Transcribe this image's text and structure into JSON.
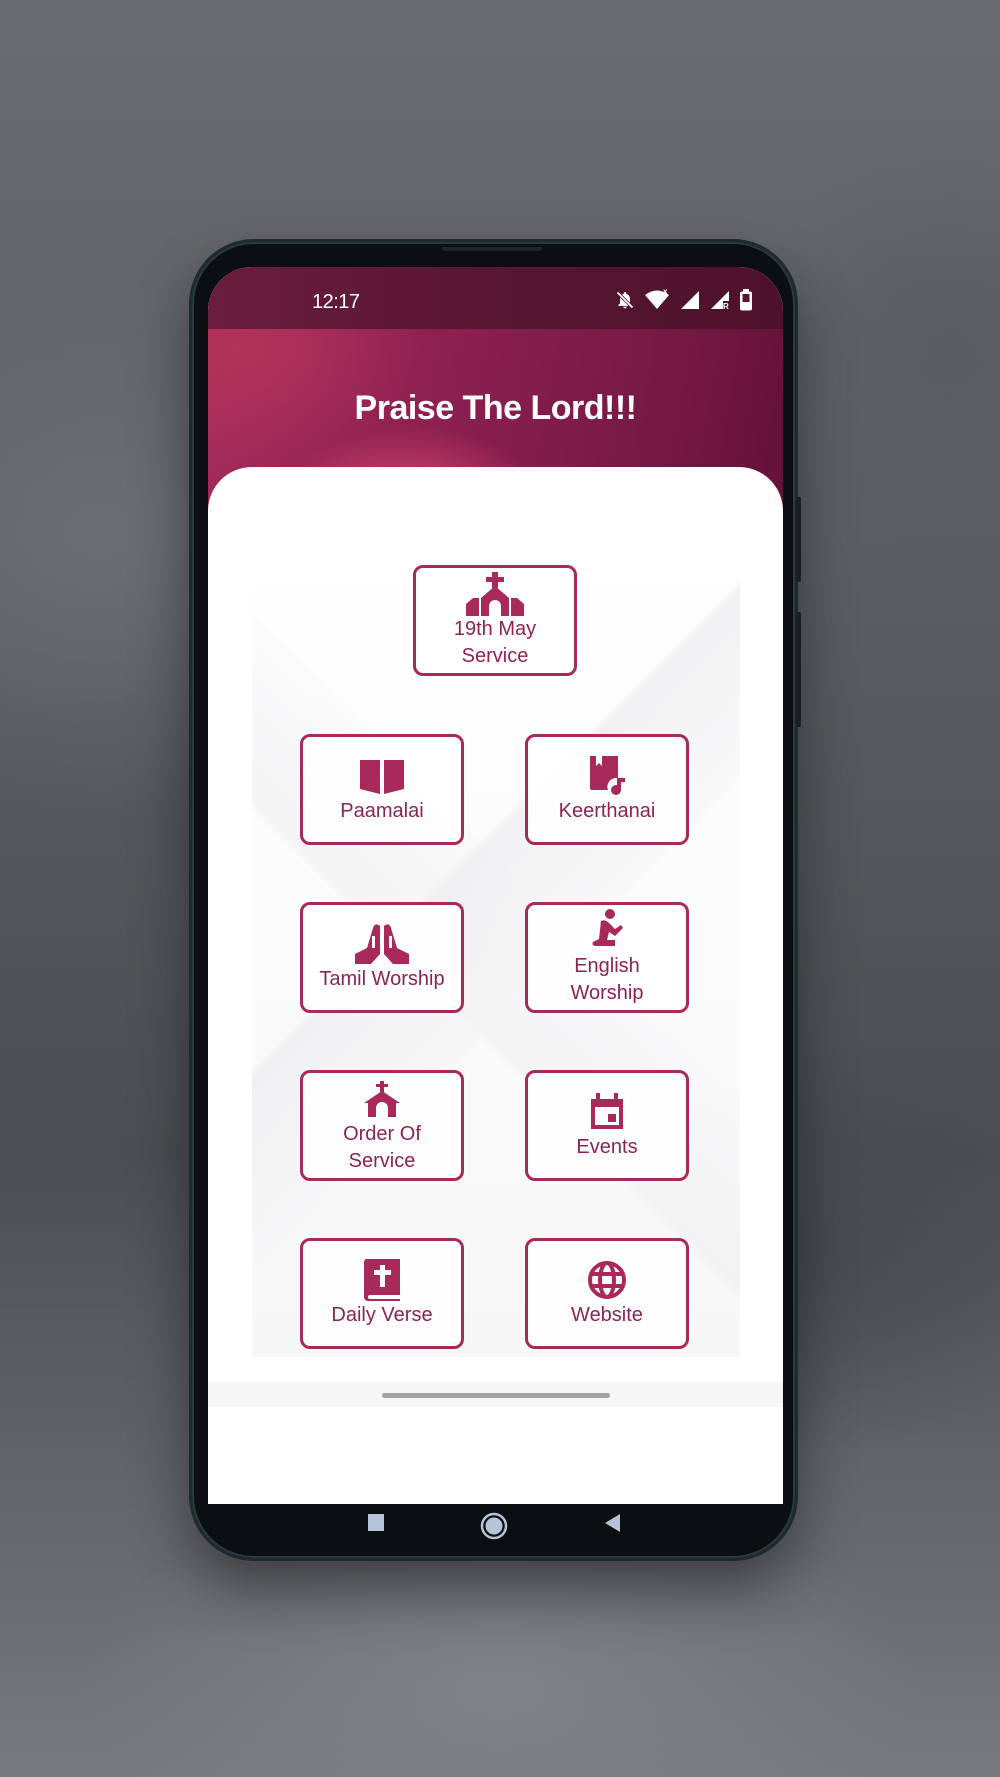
{
  "status_bar": {
    "time": "12:17",
    "icons": [
      "notifications-off-icon",
      "wifi-icon",
      "signal-no-data-icon",
      "signal-roaming-icon",
      "battery-icon"
    ]
  },
  "header": {
    "title": "Praise The Lord!!!"
  },
  "colors": {
    "accent": "#a8295a",
    "header_dark": "#571632",
    "text_accent": "#8e2352"
  },
  "menu": {
    "featured": {
      "label": "19th May Service",
      "line1": "19th May",
      "line2": "Service",
      "icon": "church-icon"
    },
    "items": [
      {
        "label": "Paamalai",
        "icon": "open-book-icon"
      },
      {
        "label": "Keerthanai",
        "icon": "music-book-icon"
      },
      {
        "label": "Tamil Worship",
        "icon": "praying-hands-icon"
      },
      {
        "label": "English Worship",
        "line1": "English",
        "line2": "Worship",
        "icon": "kneeling-prayer-icon"
      },
      {
        "label": "Order Of Service",
        "line1": "Order Of",
        "line2": "Service",
        "icon": "chapel-icon"
      },
      {
        "label": "Events",
        "icon": "calendar-icon"
      },
      {
        "label": "Daily Verse",
        "icon": "bible-icon"
      },
      {
        "label": "Website",
        "icon": "globe-icon"
      }
    ]
  },
  "nav_bar": {
    "buttons": [
      "recents-button",
      "home-button",
      "back-button"
    ]
  }
}
